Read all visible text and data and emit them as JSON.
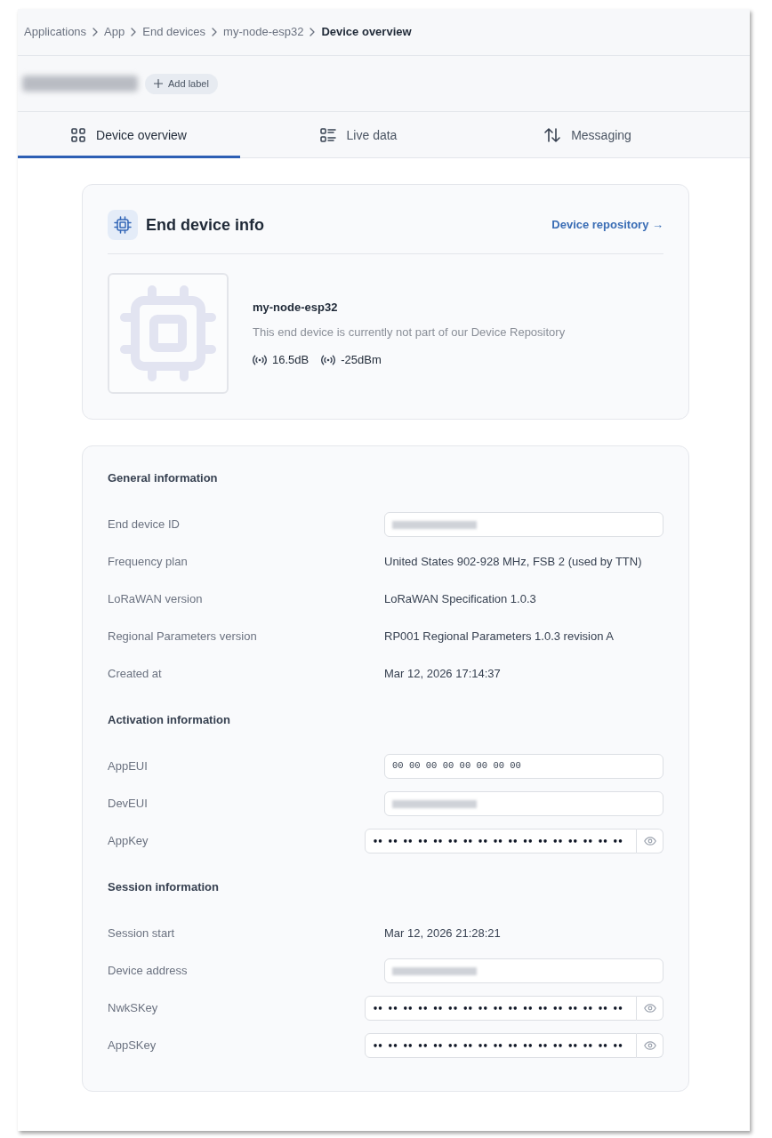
{
  "breadcrumbs": [
    {
      "label": "Applications",
      "current": false
    },
    {
      "label": "App",
      "current": false
    },
    {
      "label": "End devices",
      "current": false
    },
    {
      "label": "my-node-esp32",
      "current": false
    },
    {
      "label": "Device overview",
      "current": true
    }
  ],
  "header": {
    "title_redacted": true,
    "add_label_button": "Add label"
  },
  "tabs": [
    {
      "label": "Device overview",
      "kind": "grid",
      "selected": true
    },
    {
      "label": "Live data",
      "kind": "list",
      "selected": false
    },
    {
      "label": "Messaging",
      "kind": "arrows",
      "selected": false
    }
  ],
  "device_info": {
    "title": "End device info",
    "repository_link": "Device repository →",
    "name": "my-node-esp32",
    "description": "This end device is currently not part of our Device Repository",
    "signals": [
      {
        "reading": "16.5dB"
      },
      {
        "reading": "-25dBm"
      }
    ]
  },
  "sections": [
    {
      "title": "General information",
      "rows": [
        {
          "label": "End device ID",
          "kind": "field",
          "redacted": true
        },
        {
          "label": "Frequency plan",
          "kind": "text",
          "value": "United States 902-928 MHz, FSB 2 (used by TTN)"
        },
        {
          "label": "LoRaWAN version",
          "kind": "text",
          "value": "LoRaWAN Specification 1.0.3"
        },
        {
          "label": "Regional Parameters version",
          "kind": "text",
          "value": "RP001 Regional Parameters 1.0.3 revision A"
        },
        {
          "label": "Created at",
          "kind": "text",
          "value": "Mar 12, 2026 17:14:37"
        }
      ]
    },
    {
      "title": "Activation information",
      "rows": [
        {
          "label": "AppEUI",
          "kind": "field",
          "redacted": false,
          "value": "00 00 00 00 00 00 00 00"
        },
        {
          "label": "DevEUI",
          "kind": "field",
          "redacted": true
        },
        {
          "label": "AppKey",
          "kind": "secret",
          "value": "•• •• •• •• •• •• •• •• •• •• •• •• •• •• •• •• ••"
        }
      ]
    },
    {
      "title": "Session information",
      "rows": [
        {
          "label": "Session start",
          "kind": "text",
          "value": "Mar 12, 2026 21:28:21"
        },
        {
          "label": "Device address",
          "kind": "field",
          "redacted": true
        },
        {
          "label": "NwkSKey",
          "kind": "secret",
          "value": "•• •• •• •• •• •• •• •• •• •• •• •• •• •• •• •• ••"
        },
        {
          "label": "AppSKey",
          "kind": "secret",
          "value": "•• •• •• •• •• •• •• •• •• •• •• •• •• •• •• •• ••"
        }
      ]
    }
  ]
}
